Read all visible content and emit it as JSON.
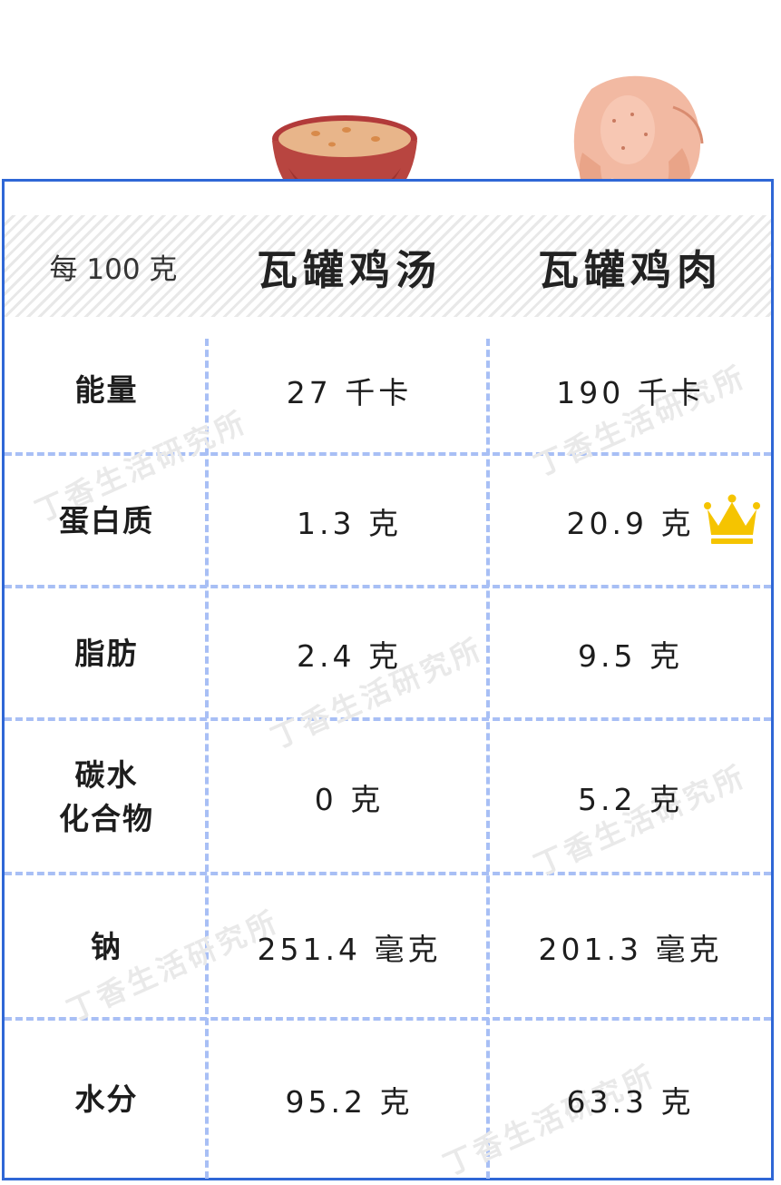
{
  "header": {
    "per_label": "每 100 克",
    "col1_title": "瓦罐鸡汤",
    "col2_title": "瓦罐鸡肉"
  },
  "rows": [
    {
      "label": "能量",
      "soup": "27 千卡",
      "meat": "190 千卡"
    },
    {
      "label": "蛋白质",
      "soup": "1.3 克",
      "meat": "20.9 克",
      "meat_badge": "crown-icon"
    },
    {
      "label": "脂肪",
      "soup": "2.4 克",
      "meat": "9.5 克"
    },
    {
      "label": "碳水\n化合物",
      "soup": "0 克",
      "meat": "5.2 克"
    },
    {
      "label": "钠",
      "soup": "251.4 毫克",
      "meat": "201.3 毫克"
    },
    {
      "label": "水分",
      "soup": "95.2 克",
      "meat": "63.3 克"
    }
  ],
  "watermark": "丁香生活研究所",
  "colors": {
    "frame": "#2f67d6",
    "divider": "#a8bff5",
    "crown": "#f5c400"
  }
}
